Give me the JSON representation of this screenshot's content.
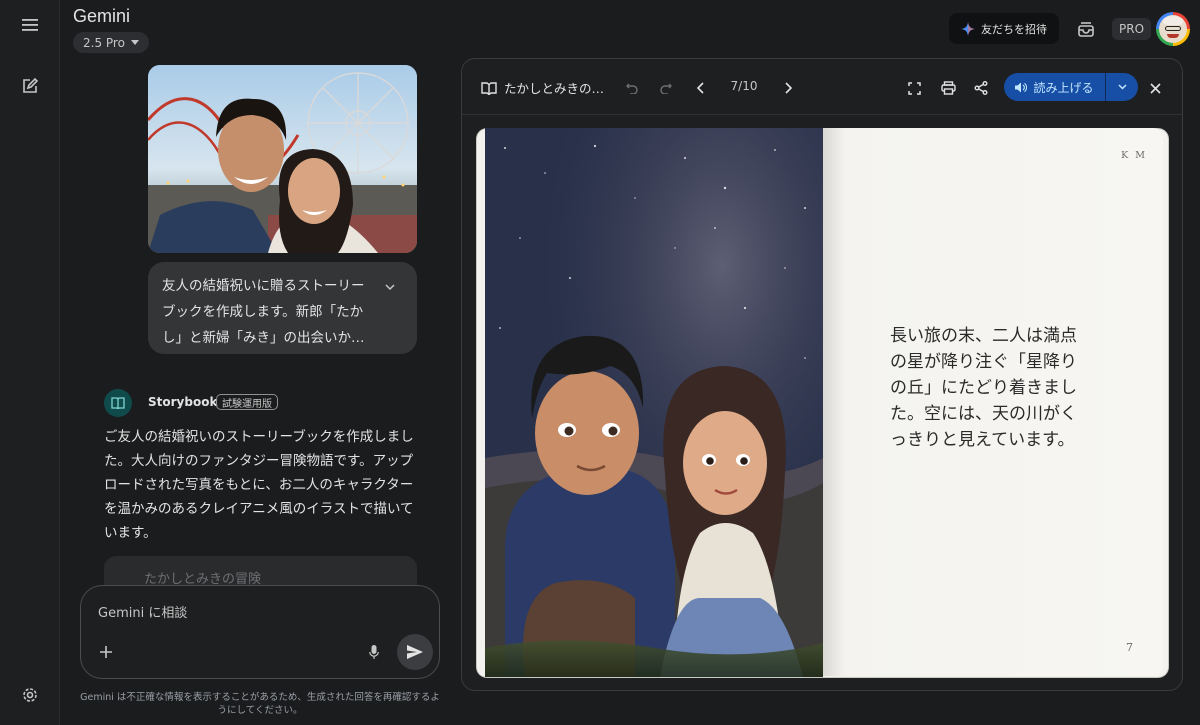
{
  "app": {
    "title": "Gemini",
    "model": "2.5 Pro",
    "invite_label": "友だちを招待",
    "plan_badge": "PRO"
  },
  "chat": {
    "user_message": "友人の結婚祝いに贈るストーリーブックを作成します。新郎「たかし」と新婦「みき」の出会いか…",
    "agent_name": "Storybook",
    "agent_badge": "試験運用版",
    "reply": "ご友人の結婚祝いのストーリーブックを作成しました。大人向けのファンタジー冒険物語です。アップロードされた写真をもとに、お二人のキャラクターを温かみのあるクレイアニメ風のイラストで描いています。",
    "card_title": "たかしとみきの冒険",
    "input_placeholder": "Gemini に相談",
    "disclaimer": "Gemini は不正確な情報を表示することがあるため、生成された回答を再確認するようにしてください。"
  },
  "viewer": {
    "title": "たかしとみきの…",
    "page_indicator": "7/10",
    "read_aloud_label": "読み上げる",
    "page": {
      "initials": "K M",
      "text": "長い旅の末、二人は満点の星が降り注ぐ「星降りの丘」にたどり着きました。空には、天の川がくっきりと見えています。",
      "number": "7"
    }
  },
  "colors": {
    "background": "#1b1c1e",
    "surface": "#333537",
    "accent": "#174ea6",
    "accent_text": "#c2e7ff",
    "agent_icon_bg": "#104b4c"
  },
  "icons": [
    "menu-icon",
    "edit-icon",
    "settings-icon",
    "chevron-down-icon",
    "sparkle-icon",
    "inbox-icon",
    "book-icon",
    "undo-icon",
    "redo-icon",
    "chevron-left-icon",
    "chevron-right-icon",
    "fullscreen-icon",
    "print-icon",
    "share-icon",
    "speaker-icon",
    "close-icon",
    "plus-icon",
    "mic-icon",
    "send-icon"
  ]
}
